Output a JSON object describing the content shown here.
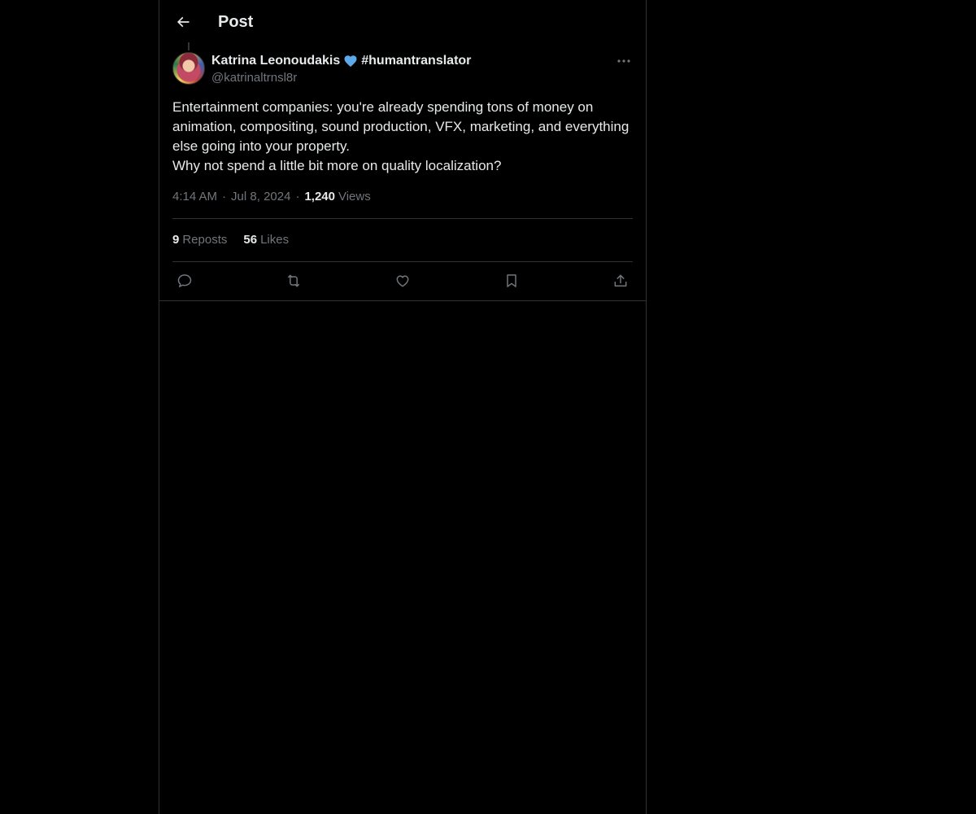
{
  "header": {
    "title": "Post"
  },
  "post": {
    "author_name": "Katrina Leonoudakis",
    "author_tag": "#humantranslator",
    "handle": "@katrinaltrnsl8r",
    "text_lines": [
      "Entertainment companies: you're already spending tons of money on animation, compositing, sound production, VFX, marketing, and everything else going into your property.",
      "Why not spend a little bit more on quality localization?"
    ],
    "time": "4:14 AM",
    "date": "Jul 8, 2024",
    "separator": "·",
    "views_count": "1,240",
    "views_label": "Views",
    "reposts_count": "9",
    "reposts_label": "Reposts",
    "likes_count": "56",
    "likes_label": "Likes"
  },
  "colors": {
    "background": "#000000",
    "text": "#e7e9ea",
    "muted": "#71767b",
    "border": "#2f3336",
    "heart_emoji": "#5da9e9"
  },
  "icons": {
    "back": "arrow-left-icon",
    "emoji": "blue-heart-icon",
    "more": "more-horizontal-icon",
    "reply": "reply-icon",
    "repost": "repost-icon",
    "like": "like-heart-icon",
    "bookmark": "bookmark-icon",
    "share": "share-icon"
  }
}
